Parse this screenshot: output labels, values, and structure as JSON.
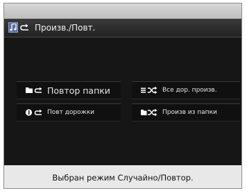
{
  "header": {
    "title": "Произв./Повт.",
    "icon": "music-repeat-icon"
  },
  "options": {
    "repeat_folder": {
      "label": "Повтор папки",
      "icon": "folder-repeat-icon"
    },
    "repeat_track": {
      "label": "Повт дорожки",
      "icon": "track-repeat-icon"
    },
    "shuffle_all": {
      "label": "Все дор. произв.",
      "icon": "shuffle-all-icon"
    },
    "shuffle_folder": {
      "label": "Произв из папки",
      "icon": "folder-shuffle-icon"
    }
  },
  "status": {
    "message": "Выбран режим Случайно/Повтор."
  },
  "colors": {
    "screen_bg": "#161616",
    "title_bg": "#2b2b2b",
    "status_bg": "#e8e8e8",
    "icon_accent": "#5a6fa0"
  }
}
